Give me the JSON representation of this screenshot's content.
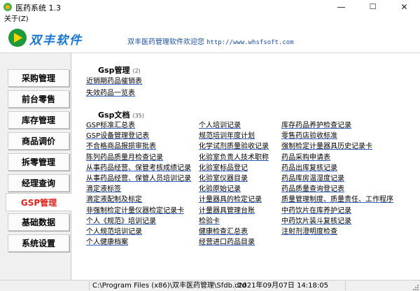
{
  "window": {
    "title": "医药系统 1.3",
    "minimize": "—",
    "maximize": "☐",
    "close": "✕"
  },
  "menu": {
    "about": "关于(Z)"
  },
  "banner": {
    "logo_text": "双丰软件",
    "welcome": "双丰医药管理软件欢迎您",
    "url": "http://www.whsfsoft.com"
  },
  "sidebar": {
    "items": [
      {
        "label": "采购管理"
      },
      {
        "label": "前台零售"
      },
      {
        "label": "库存管理"
      },
      {
        "label": "商品调价"
      },
      {
        "label": "拆零管理"
      },
      {
        "label": "经理查询"
      },
      {
        "label": "GSP管理",
        "active": true
      },
      {
        "label": "基础数据"
      },
      {
        "label": "系统设置"
      }
    ]
  },
  "gsp_manage": {
    "title": "Gsp管理",
    "count": "(2)",
    "links": [
      "近销期药品催销表",
      "失效药品一览表"
    ]
  },
  "gsp_docs": {
    "title": "Gsp文档",
    "count": "(35)",
    "col1": [
      "GSP标准汇总表",
      "GSP设备管理登记表",
      "不合格商品报损审批表",
      "陈列药品质量月检查记录",
      "从事药品经营、保管考核成绩记录",
      "从事药品经营、保管人员培训记录",
      "滴定液标签",
      "滴定液配制及标定",
      "非强制检定计量仪器检定记录卡",
      "个人《规范》培训记录",
      "个人规范培训记录",
      "个人健康档案"
    ],
    "col2": [
      "个人培训记录",
      "规范培训年度计划",
      "化学试剂质量验收记录",
      "化验室负责人技术职称",
      "化验室标品登记",
      "化验室仪器目录",
      "化验原始记录",
      "计量器具的检定记录",
      "计量器具管理台账",
      "检验卡",
      "健康检查汇总表",
      "经营进口药品目录"
    ],
    "col3": [
      "库存药品养护检查记录",
      "零售药店验收标准",
      "强制检定计量器具历史记录卡",
      "药品采购申请表",
      "药品出库复核记录",
      "药品库房温湿度记录",
      "药品质量查询登记表",
      "质量管理制度、质量责任、工作程序",
      "中药饮片在库养护记录",
      "中药饮片装斗复核记录",
      "注射剂澄明度检查"
    ]
  },
  "status": {
    "path": "C:\\Program Files (x86)\\双丰医药管理\\Sfdb.dtd",
    "datetime": "2021年09月07日 14:18:05"
  }
}
